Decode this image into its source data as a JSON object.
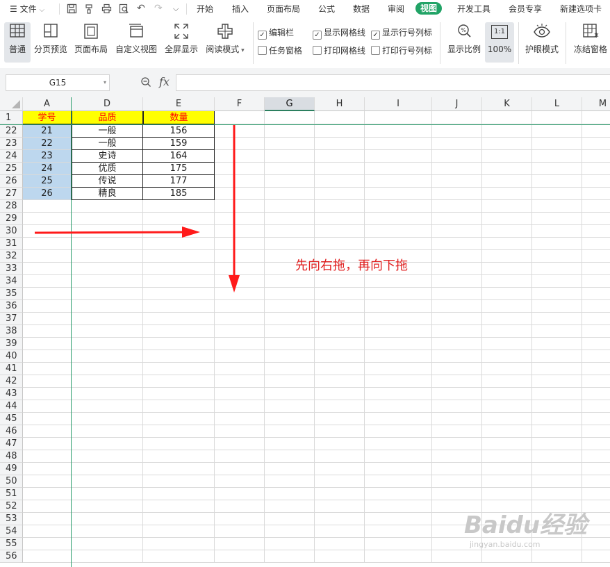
{
  "menu": {
    "file_label": "文件",
    "tabs": [
      "开始",
      "插入",
      "页面布局",
      "公式",
      "数据",
      "审阅",
      "视图",
      "开发工具",
      "会员专享",
      "新建选项卡"
    ],
    "active_tab": "视图"
  },
  "ribbon": {
    "views": [
      "普通",
      "分页预览",
      "页面布局",
      "自定义视图",
      "全屏显示",
      "阅读模式"
    ],
    "show_options": [
      {
        "label": "编辑栏",
        "checked": true
      },
      {
        "label": "显示网格线",
        "checked": true
      },
      {
        "label": "显示行号列标",
        "checked": true
      },
      {
        "label": "任务窗格",
        "checked": false
      },
      {
        "label": "打印网格线",
        "checked": false
      },
      {
        "label": "打印行号列标",
        "checked": false
      }
    ],
    "zoom_label": "显示比例",
    "zoom_100_icon_text": "1:1",
    "zoom_100_label": "100%",
    "eye_label": "护眼模式",
    "freeze_label": "冻结窗格"
  },
  "formula_bar": {
    "cell_ref": "G15",
    "fx": "fx",
    "value": ""
  },
  "sheet": {
    "columns": [
      "A",
      "D",
      "E",
      "F",
      "G",
      "H",
      "I",
      "J",
      "K",
      "L",
      "M"
    ],
    "selected_column": "G",
    "header_row": {
      "row": "1",
      "cells": [
        "学号",
        "品质",
        "数量"
      ]
    },
    "rows": [
      {
        "row": "22",
        "cells": [
          "21",
          "一般",
          "156"
        ]
      },
      {
        "row": "23",
        "cells": [
          "22",
          "一般",
          "159"
        ]
      },
      {
        "row": "24",
        "cells": [
          "23",
          "史诗",
          "164"
        ]
      },
      {
        "row": "25",
        "cells": [
          "24",
          "优质",
          "175"
        ]
      },
      {
        "row": "26",
        "cells": [
          "25",
          "传说",
          "177"
        ]
      },
      {
        "row": "27",
        "cells": [
          "26",
          "精良",
          "185"
        ]
      }
    ],
    "empty_rows": [
      "28",
      "29",
      "30",
      "31",
      "32",
      "33",
      "34",
      "35",
      "36",
      "37",
      "38",
      "39",
      "40",
      "41",
      "42",
      "43",
      "44",
      "45",
      "46",
      "47",
      "48",
      "49",
      "50",
      "51",
      "52",
      "53",
      "54",
      "55",
      "56"
    ]
  },
  "annotation": {
    "text": "先向右拖，再向下拖",
    "color": "#e02020"
  },
  "watermark": {
    "brand": "Baidu经验",
    "url": "jingyan.baidu.com"
  },
  "colors": {
    "accent": "#21a366",
    "header_fill": "#ffff00",
    "header_text": "#ff0000",
    "id_fill": "#bdd7ee"
  }
}
